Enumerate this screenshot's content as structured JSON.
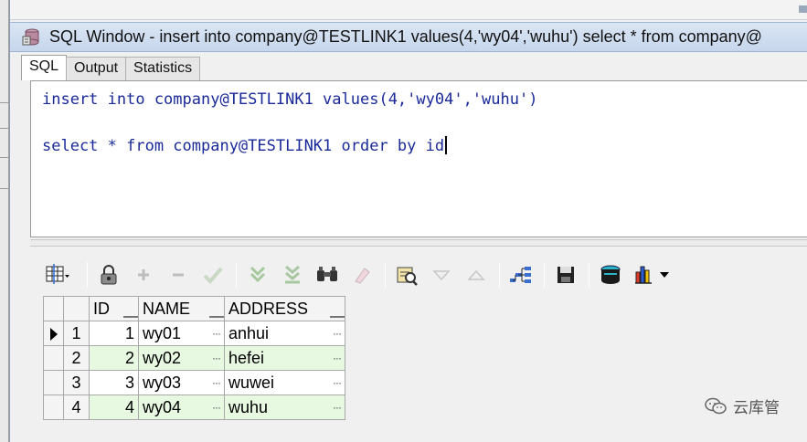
{
  "window": {
    "title": "SQL Window - insert into company@TESTLINK1 values(4,'wy04','wuhu') select * from company@"
  },
  "tabs": [
    {
      "label": "SQL",
      "active": true
    },
    {
      "label": "Output",
      "active": false
    },
    {
      "label": "Statistics",
      "active": false
    }
  ],
  "editor": {
    "lines": [
      "insert into company@TESTLINK1 values(4,'wy04','wuhu')",
      "select * from company@TESTLINK1 order by id"
    ],
    "text_color": "#1a2a9a"
  },
  "toolbar": {
    "icons": [
      "grid-options-icon",
      "lock-icon",
      "add-record-icon",
      "delete-record-icon",
      "post-changes-icon",
      "fetch-next-page-icon",
      "fetch-last-page-icon",
      "find-icon",
      "clear-icon",
      "query-by-example-icon",
      "sort-descending-icon",
      "sort-ascending-icon",
      "exact-query-icon",
      "save-results-icon",
      "export-icon",
      "chart-icon"
    ]
  },
  "grid": {
    "columns": [
      "ID",
      "NAME",
      "ADDRESS"
    ],
    "rows": [
      {
        "num": "1",
        "id": "1",
        "name": "wy01",
        "address": "anhui",
        "current": true
      },
      {
        "num": "2",
        "id": "2",
        "name": "wy02",
        "address": "hefei",
        "current": false
      },
      {
        "num": "3",
        "id": "3",
        "name": "wy03",
        "address": "wuwei",
        "current": false
      },
      {
        "num": "4",
        "id": "4",
        "name": "wy04",
        "address": "wuhu",
        "current": false
      }
    ],
    "cell_ellipsis": "···",
    "even_row_color": "#e8f9e2"
  },
  "watermark": {
    "text": "云库管"
  }
}
